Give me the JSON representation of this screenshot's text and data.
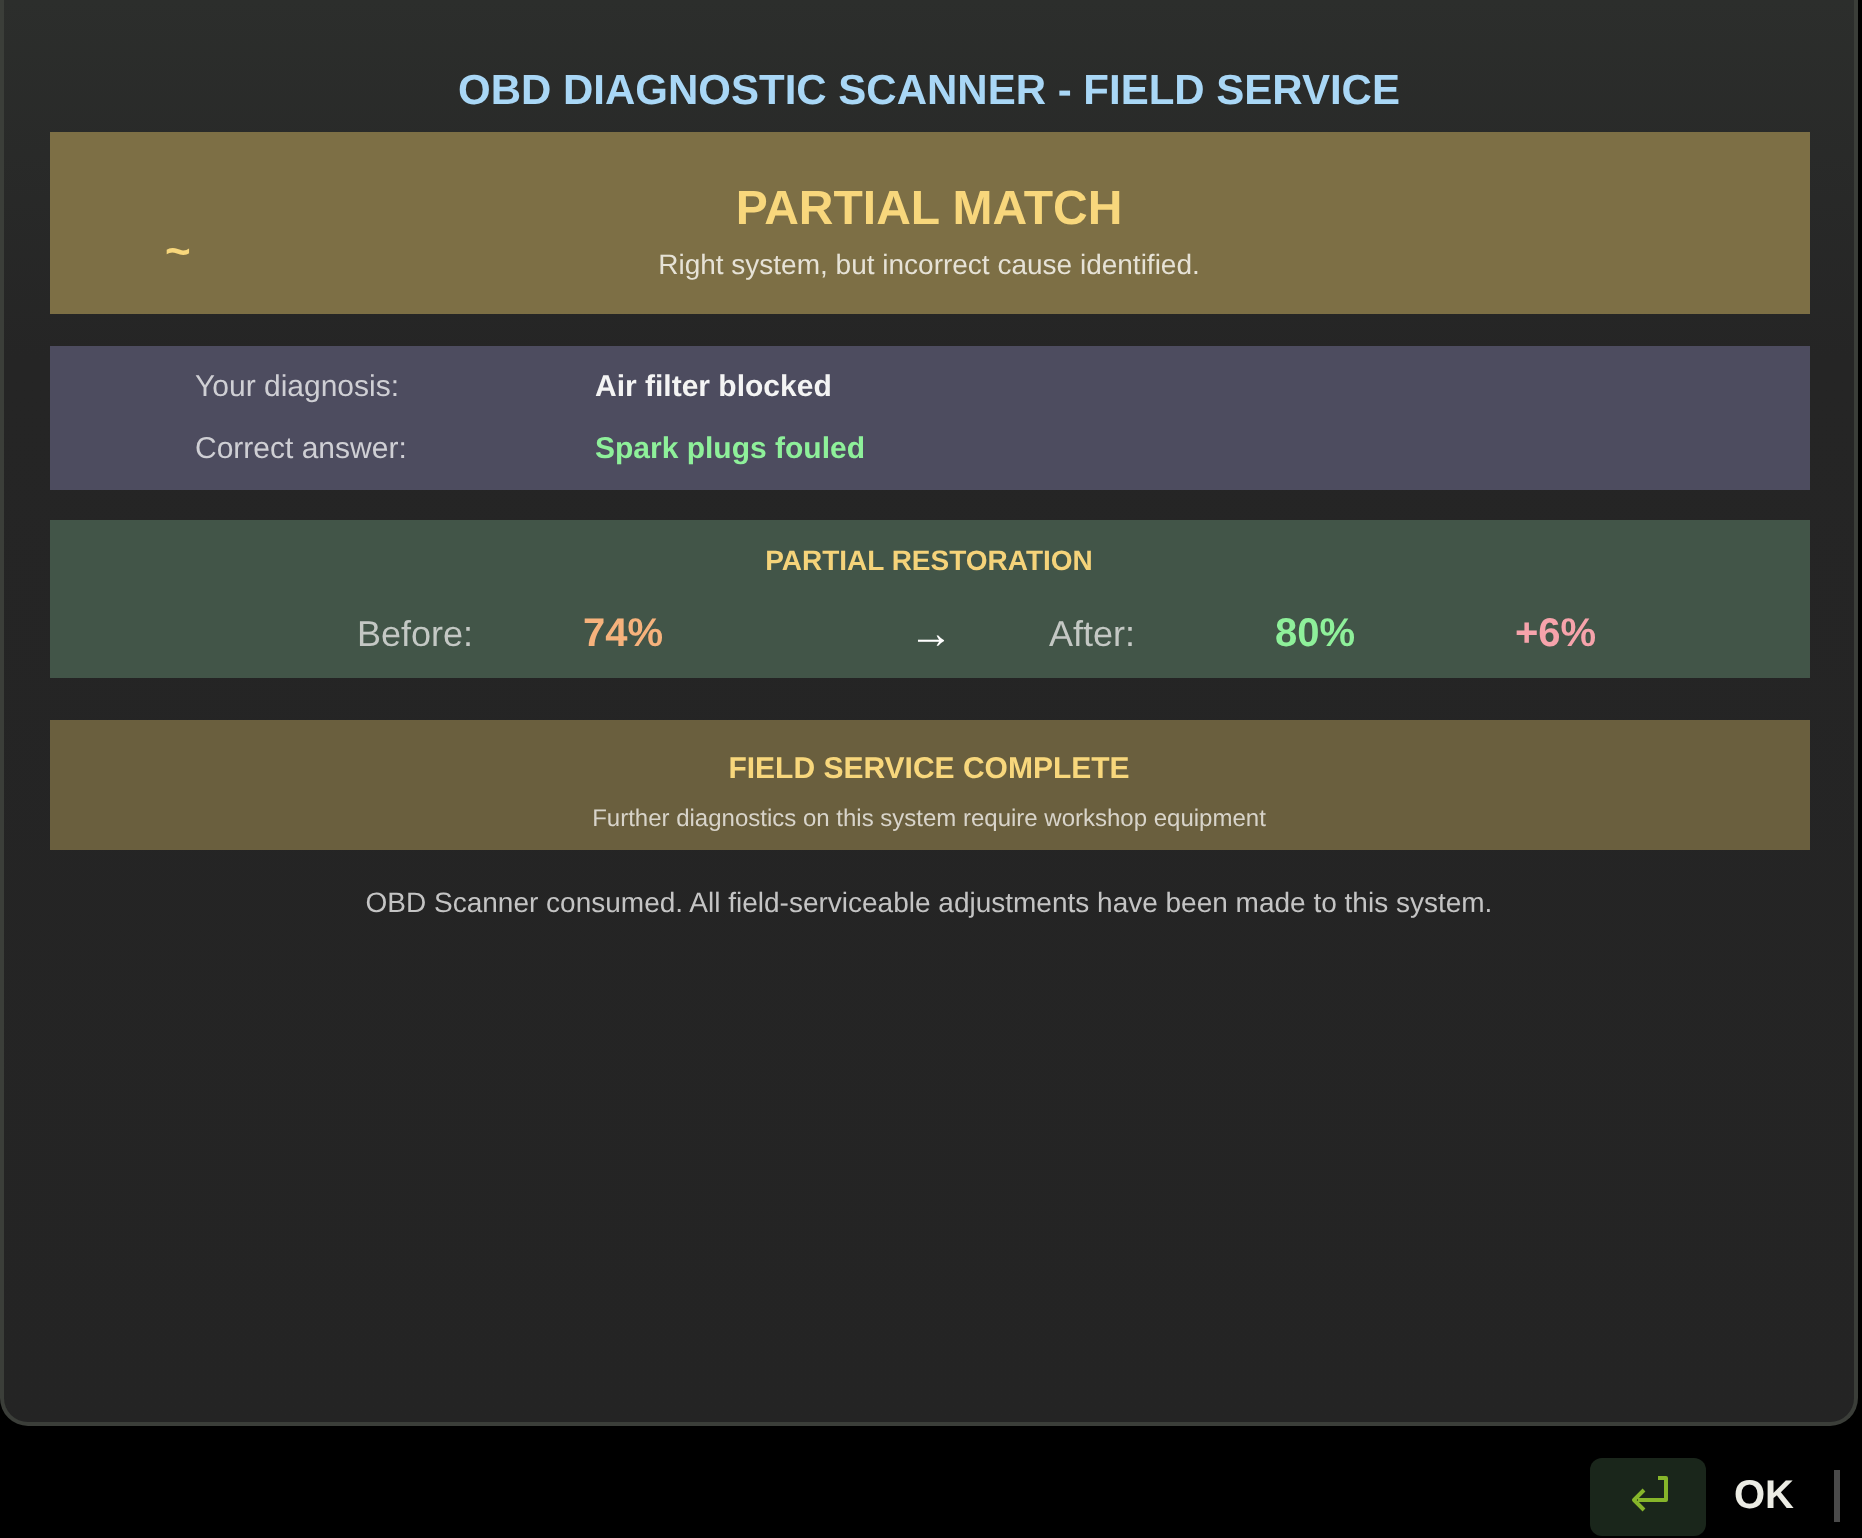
{
  "title": "OBD DIAGNOSTIC SCANNER - FIELD SERVICE",
  "result": {
    "glyph": "~",
    "heading": "PARTIAL MATCH",
    "message": "Right system, but incorrect cause identified."
  },
  "diagnosis": [
    {
      "kind": "given",
      "label": "Your diagnosis:",
      "value": "Air filter blocked"
    },
    {
      "kind": "correct",
      "label": "Correct answer:",
      "value": "Spark plugs fouled"
    }
  ],
  "restoration": {
    "heading": "PARTIAL RESTORATION",
    "before_label": "Before:",
    "before_value": "74%",
    "arrow": "→",
    "after_label": "After:",
    "after_value": "80%",
    "change": "+6%"
  },
  "notice": {
    "heading": "FIELD SERVICE COMPLETE",
    "message": "Further diagnostics on this system require workshop equipment"
  },
  "footnote": "OBD Scanner consumed. All field-serviceable adjustments have been made to this system.",
  "prompt_bar": {
    "confirm_label": "OK"
  }
}
